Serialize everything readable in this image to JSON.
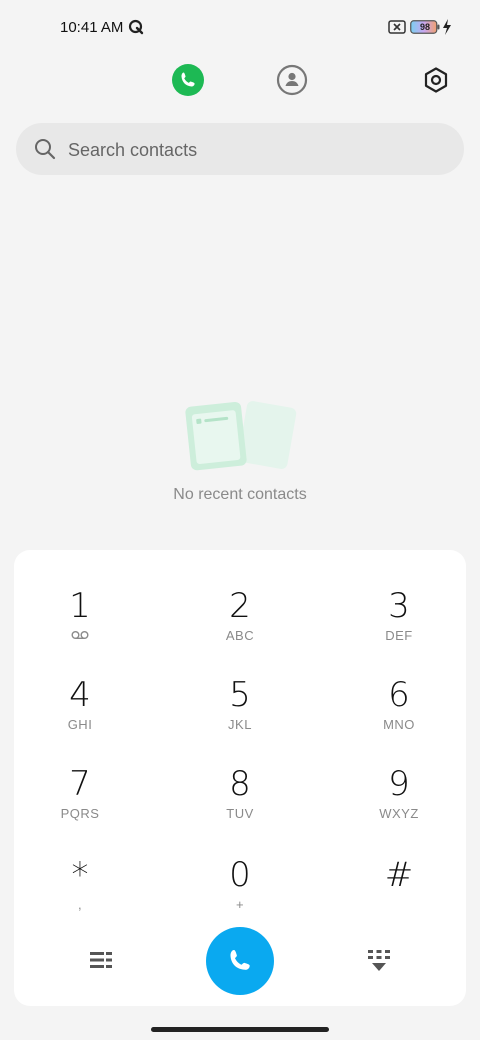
{
  "status_bar": {
    "time": "10:41 AM",
    "battery_level": "98",
    "icons": [
      "q-icon",
      "sim-off-icon",
      "battery-icon",
      "charging-bolt-icon"
    ]
  },
  "top_nav": {
    "tabs": [
      {
        "icon": "phone-icon",
        "active": true
      },
      {
        "icon": "contacts-icon",
        "active": false
      }
    ],
    "settings_icon": "settings-hex-icon",
    "active_color": "#1db954"
  },
  "search": {
    "placeholder": "Search contacts",
    "value": ""
  },
  "empty_state": {
    "text": "No recent contacts",
    "icon": "empty-cards-illustration"
  },
  "keypad": {
    "keys": [
      {
        "digit": "1",
        "letters": ""
      },
      {
        "digit": "2",
        "letters": "ABC"
      },
      {
        "digit": "3",
        "letters": "DEF"
      },
      {
        "digit": "4",
        "letters": "GHI"
      },
      {
        "digit": "5",
        "letters": "JKL"
      },
      {
        "digit": "6",
        "letters": "MNO"
      },
      {
        "digit": "7",
        "letters": "PQRS"
      },
      {
        "digit": "8",
        "letters": "TUV"
      },
      {
        "digit": "9",
        "letters": "WXYZ"
      },
      {
        "digit": "*",
        "letters": ","
      },
      {
        "digit": "0",
        "letters": "+"
      },
      {
        "digit": "#",
        "letters": ""
      }
    ],
    "voicemail_icon": "voicemail-icon",
    "actions": {
      "menu_icon": "menu-lines-icon",
      "call_icon": "call-icon",
      "call_color": "#0aa9f0",
      "hide_icon": "hide-keypad-icon"
    }
  }
}
